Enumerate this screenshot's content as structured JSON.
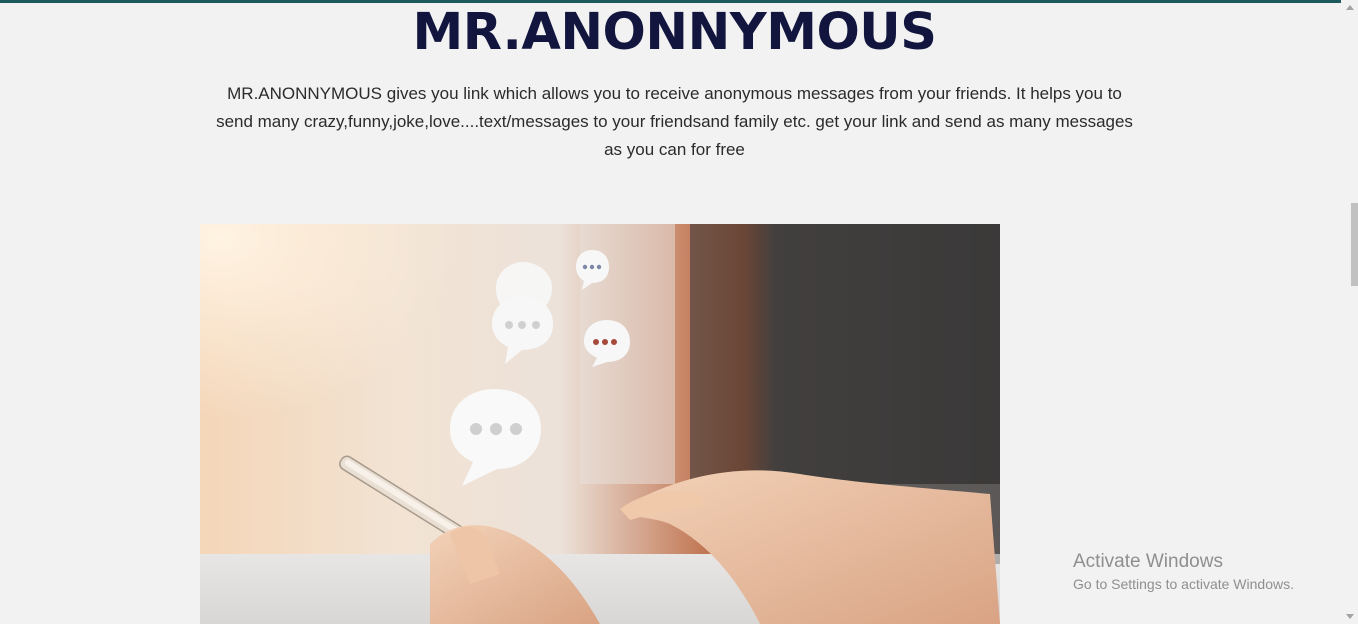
{
  "hero": {
    "title": "MR.ANONNYMOUS",
    "description": "MR.ANONNYMOUS gives you link which allows you to receive anonymous messages from your friends. It helps you to send many crazy,funny,joke,love....text/messages to your friendsand family etc. get your link and send as many messages as you can for free"
  },
  "image": {
    "icon": "phone-with-chat-bubbles-photo"
  },
  "watermark": {
    "title": "Activate Windows",
    "subtitle": "Go to Settings to activate Windows."
  },
  "colors": {
    "accent_bar": "#1d5a5e",
    "title": "#12163f",
    "background": "#f2f2f2"
  }
}
